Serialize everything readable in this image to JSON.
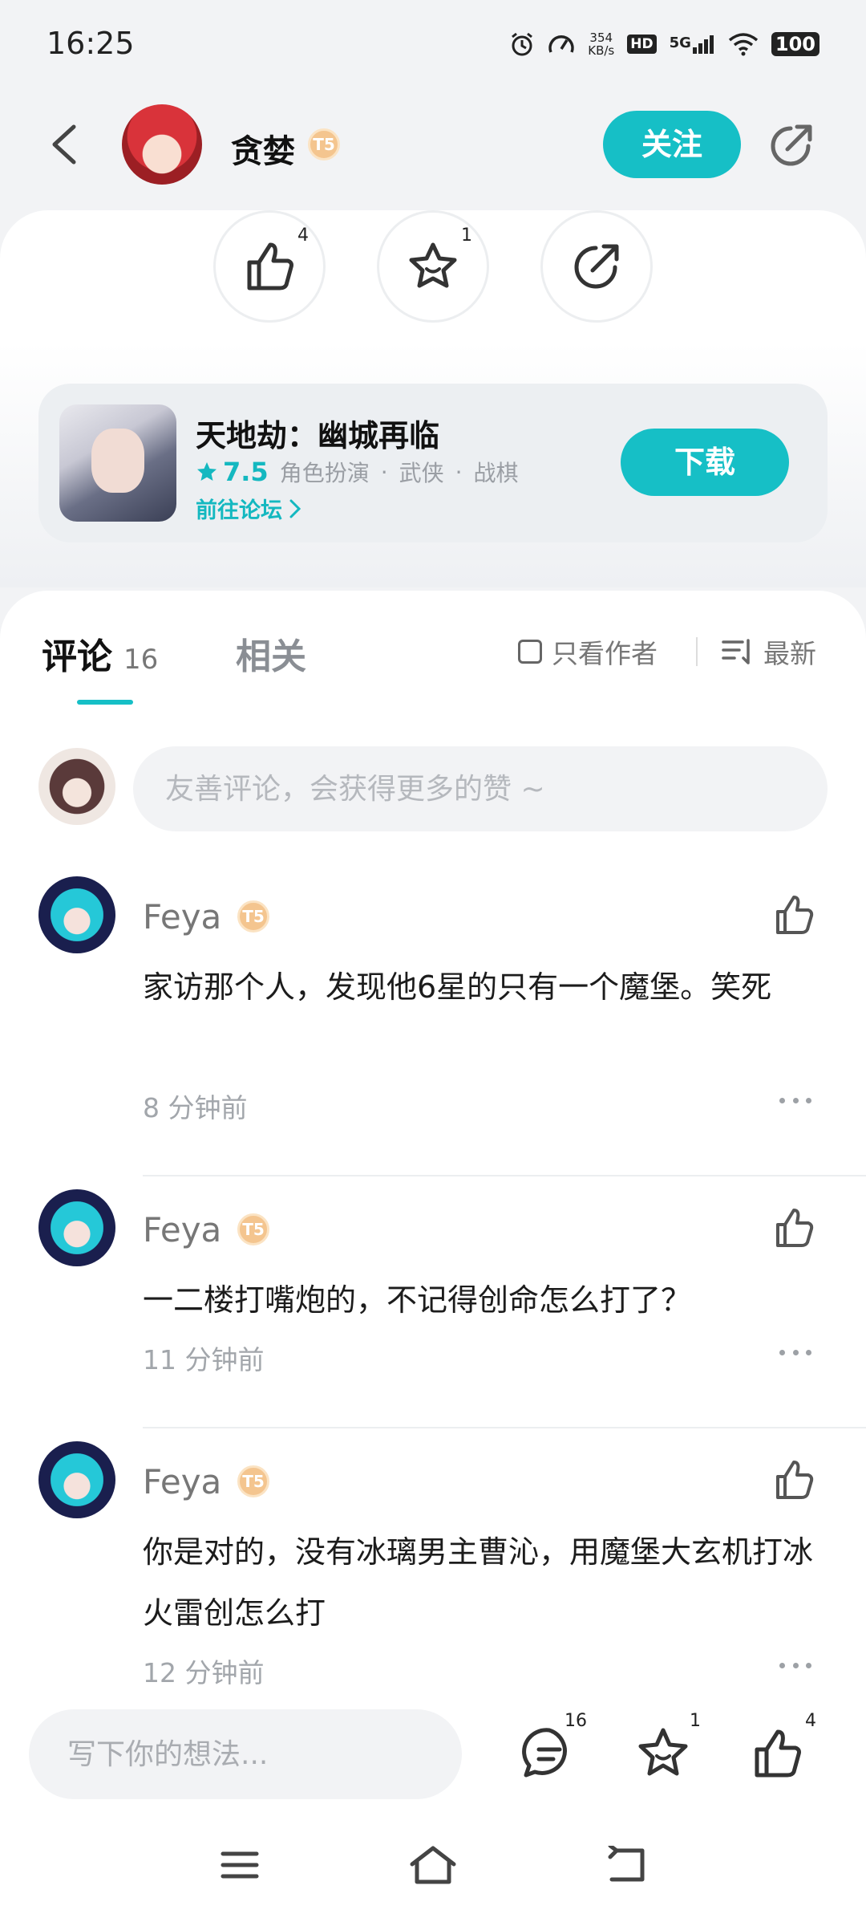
{
  "status_bar": {
    "time": "16:25",
    "net_speed_value": "354",
    "net_speed_unit": "KB/s",
    "hd": "HD",
    "network": "5G",
    "battery": "100"
  },
  "header": {
    "username": "贪婪",
    "level_badge": "T5",
    "follow_label": "关注"
  },
  "actions": {
    "like_count": "4",
    "favorite_count": "1"
  },
  "game": {
    "title": "天地劫：幽城再临",
    "rating": "7.5",
    "tags": [
      "角色扮演",
      "武侠",
      "战棋"
    ],
    "separator": "·",
    "forum_link": "前往论坛",
    "download_label": "下载"
  },
  "comments_section": {
    "tab_comments": "评论",
    "comment_count": "16",
    "tab_related": "相关",
    "filter_author": "只看作者",
    "sort_label": "最新",
    "input_placeholder": "友善评论，会获得更多的赞 ~"
  },
  "comments": [
    {
      "author": "Feya",
      "badge": "T5",
      "text": "家访那个人，发现他6星的只有一个魔堡。笑死",
      "time": "8 分钟前"
    },
    {
      "author": "Feya",
      "badge": "T5",
      "text": "一二楼打嘴炮的，不记得创命怎么打了？",
      "time": "11 分钟前"
    },
    {
      "author": "Feya",
      "badge": "T5",
      "text": "你是对的，没有冰璃男主曹沁，用魔堡大玄机打冰火雷创怎么打",
      "time": "12 分钟前"
    }
  ],
  "bottom_bar": {
    "input_placeholder": "写下你的想法...",
    "comment_count": "16",
    "favorite_count": "1",
    "like_count": "4"
  },
  "colors": {
    "accent": "#16bfc6",
    "background": "#f2f3f5",
    "badge": "#f4c58f"
  }
}
